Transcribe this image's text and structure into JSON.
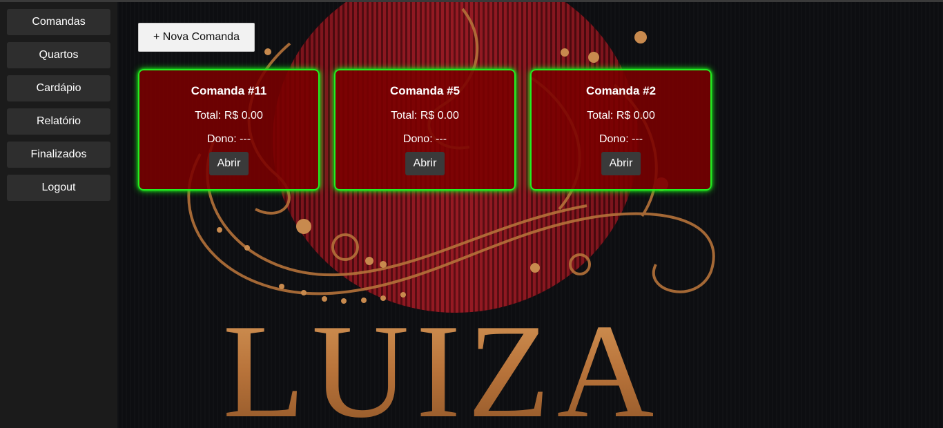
{
  "sidebar": {
    "items": [
      {
        "label": "Comandas"
      },
      {
        "label": "Quartos"
      },
      {
        "label": "Cardápio"
      },
      {
        "label": "Relatório"
      },
      {
        "label": "Finalizados"
      },
      {
        "label": "Logout"
      }
    ]
  },
  "toolbar": {
    "new_label": "+ Nova Comanda"
  },
  "cards": [
    {
      "title": "Comanda #11",
      "total": "Total: R$ 0.00",
      "owner": "Dono: ---",
      "button": "Abrir"
    },
    {
      "title": "Comanda #5",
      "total": "Total: R$ 0.00",
      "owner": "Dono: ---",
      "button": "Abrir"
    },
    {
      "title": "Comanda #2",
      "total": "Total: R$ 0.00",
      "owner": "Dono: ---",
      "button": "Abrir"
    }
  ],
  "background": {
    "logo_text": "LUIZA"
  },
  "colors": {
    "card_bg": "#7a0000",
    "card_border": "#22ee22",
    "sidebar_bg": "#1b1b1b",
    "gold": "#b9773f"
  }
}
